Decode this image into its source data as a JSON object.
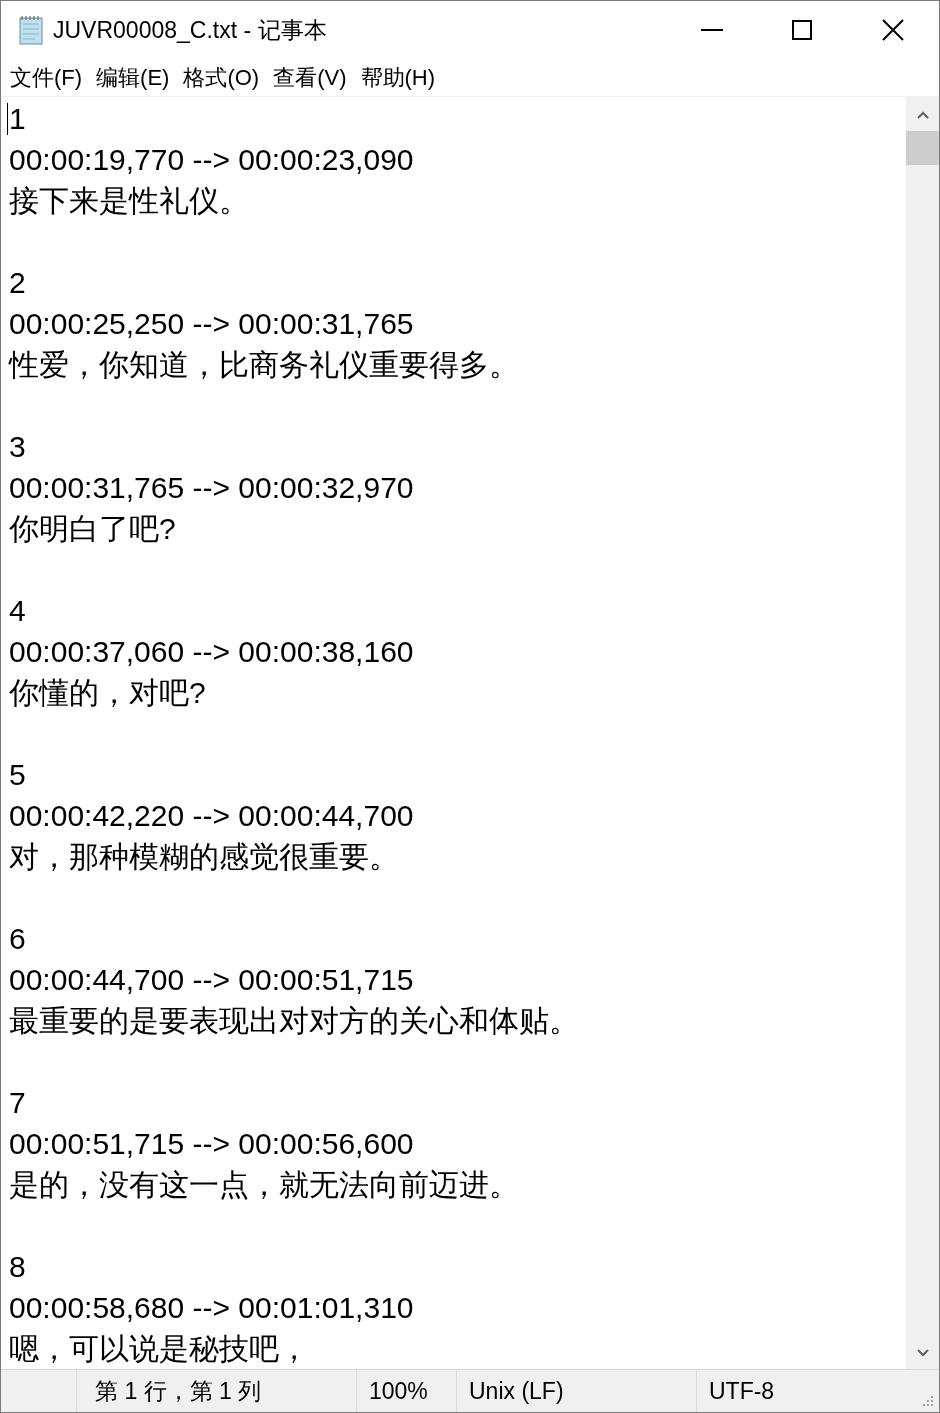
{
  "window": {
    "title": "JUVR00008_C.txt - 记事本"
  },
  "menu": [
    "文件(F)",
    "编辑(E)",
    "格式(O)",
    "查看(V)",
    "帮助(H)"
  ],
  "subtitles": [
    {
      "index": "1",
      "time": "00:00:19,770 --> 00:00:23,090",
      "text": "接下来是性礼仪。"
    },
    {
      "index": "2",
      "time": "00:00:25,250 --> 00:00:31,765",
      "text": "性爱，你知道，比商务礼仪重要得多。"
    },
    {
      "index": "3",
      "time": "00:00:31,765 --> 00:00:32,970",
      "text": "你明白了吧?"
    },
    {
      "index": "4",
      "time": "00:00:37,060 --> 00:00:38,160",
      "text": "你懂的，对吧?"
    },
    {
      "index": "5",
      "time": "00:00:42,220 --> 00:00:44,700",
      "text": "对，那种模糊的感觉很重要。"
    },
    {
      "index": "6",
      "time": "00:00:44,700 --> 00:00:51,715",
      "text": "最重要的是要表现出对对方的关心和体贴。"
    },
    {
      "index": "7",
      "time": "00:00:51,715 --> 00:00:56,600",
      "text": "是的，没有这一点，就无法向前迈进。"
    },
    {
      "index": "8",
      "time": "00:00:58,680 --> 00:01:01,310",
      "text": "嗯，可以说是秘技吧，"
    }
  ],
  "status_bar": {
    "position": "第 1 行，第 1 列",
    "zoom": "100%",
    "line_ending": "Unix (LF)",
    "encoding": "UTF-8"
  }
}
